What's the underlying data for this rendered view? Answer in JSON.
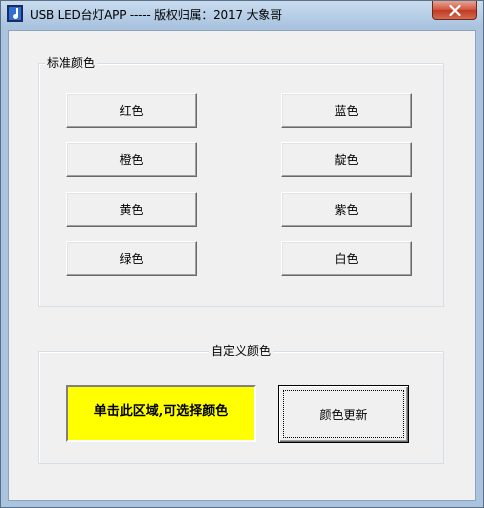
{
  "window": {
    "title": "USB LED台灯APP  ----- 版权归属：2017 大象哥",
    "close_symbol": "✕"
  },
  "standard_colors": {
    "group_title": "标准颜色",
    "buttons": {
      "red": "红色",
      "orange": "橙色",
      "yellow": "黄色",
      "green": "绿色",
      "blue": "蓝色",
      "indigo": "靛色",
      "purple": "紫色",
      "white": "白色"
    }
  },
  "custom_color": {
    "group_title": "自定义颜色",
    "area_text": "单击此区域,可选择颜色",
    "area_color": "#ffff00",
    "update_button": "颜色更新"
  }
}
